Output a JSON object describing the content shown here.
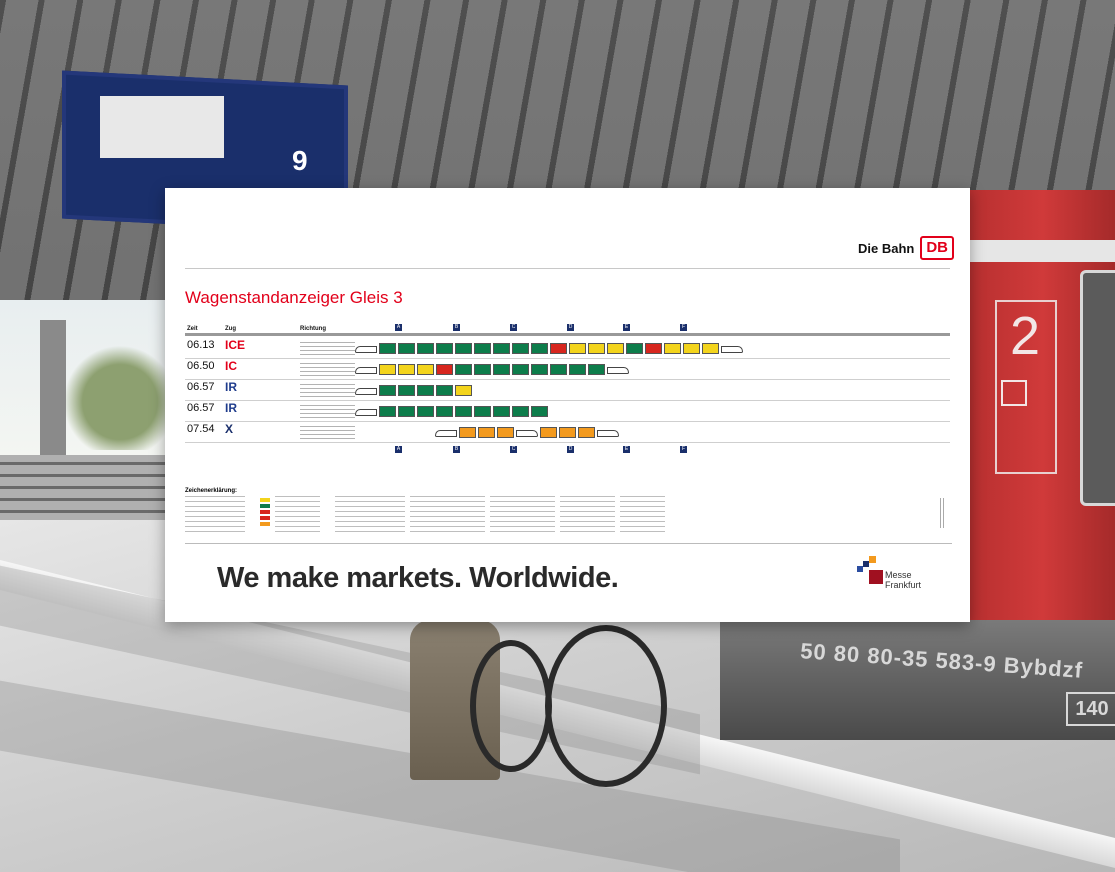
{
  "background": {
    "departure_board_track": "9",
    "door_number": "2",
    "car_number": "50 80 80-35 583-9 Bybdzf",
    "car_code": "140",
    "train_color": "#c8372f"
  },
  "poster": {
    "brand": "Die Bahn",
    "logo": "DB",
    "title": "Wagenstandanzeiger Gleis 3",
    "headers": {
      "time": "Zeit",
      "train": "Zug",
      "direction": "Richtung"
    },
    "sectors": [
      "A",
      "B",
      "C",
      "D",
      "E",
      "F"
    ],
    "trains": [
      {
        "time": "06.13",
        "type": "ICE",
        "color": "#e2001a"
      },
      {
        "time": "06.50",
        "type": "IC",
        "color": "#e2001a"
      },
      {
        "time": "06.57",
        "type": "IR",
        "color": "#1f3c8c"
      },
      {
        "time": "06.57",
        "type": "IR",
        "color": "#1f3c8c"
      },
      {
        "time": "07.54",
        "type": "X",
        "color": "#1a2f6b"
      }
    ],
    "legend_title": "Zeichenerklärung:",
    "slogan": "We make markets. Worldwide.",
    "sponsor": "Messe\nFrankfurt",
    "colors": {
      "green": "#0d7d4b",
      "yellow": "#f3d41c",
      "red": "#d7261e",
      "orange": "#f39a1e",
      "white": "#ffffff"
    }
  }
}
